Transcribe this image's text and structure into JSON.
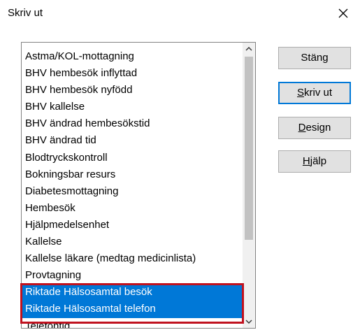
{
  "window": {
    "title": "Skriv ut"
  },
  "list": {
    "items": [
      "Astma/KOL-mottagning",
      "BHV hembesök inflyttad",
      "BHV hembesök nyfödd",
      "BHV kallelse",
      "BHV ändrad hembesökstid",
      "BHV ändrad tid",
      "Blodtryckskontroll",
      "Bokningsbar resurs",
      "Diabetesmottagning",
      "Hembesök",
      "Hjälpmedelsenhet",
      "Kallelse",
      "Kallelse läkare (medtag medicinlista)",
      "Provtagning",
      "Riktade Hälsosamtal besök",
      "Riktade Hälsosamtal telefon",
      "Telefontid"
    ],
    "selected": [
      "Riktade Hälsosamtal besök",
      "Riktade Hälsosamtal telefon"
    ]
  },
  "buttons": {
    "close": {
      "label": "Stäng"
    },
    "print": {
      "accel": "S",
      "rest": "kriv ut"
    },
    "design": {
      "accel": "D",
      "rest": "esign"
    },
    "help": {
      "accel": "H",
      "rest": "jälp"
    }
  },
  "colors": {
    "selection": "#0078d7",
    "highlight_border": "#c0121f",
    "default_button_border": "#0078d7"
  },
  "icons": {
    "close": "close-icon",
    "scroll_up": "chevron-up-icon",
    "scroll_down": "chevron-down-icon"
  }
}
